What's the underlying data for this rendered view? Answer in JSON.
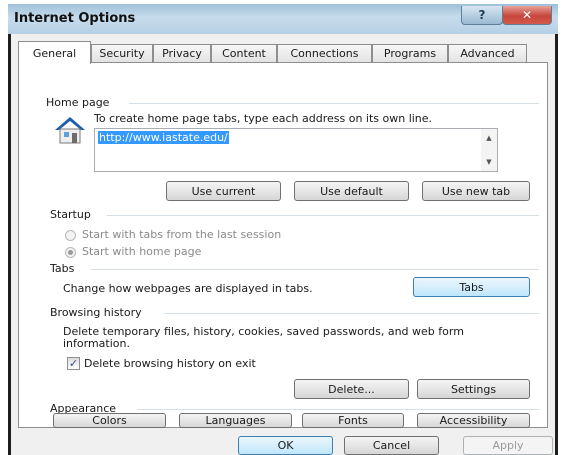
{
  "window": {
    "title": "Internet Options",
    "help_label": "?",
    "close_label": "✕"
  },
  "tabs": [
    {
      "label": "General",
      "active": true
    },
    {
      "label": "Security",
      "active": false
    },
    {
      "label": "Privacy",
      "active": false
    },
    {
      "label": "Content",
      "active": false
    },
    {
      "label": "Connections",
      "active": false
    },
    {
      "label": "Programs",
      "active": false
    },
    {
      "label": "Advanced",
      "active": false
    }
  ],
  "home_page": {
    "group_label": "Home page",
    "icon": "house-icon",
    "instructions": "To create home page tabs, type each address on its own line.",
    "url_value": "http://www.iastate.edu/",
    "buttons": {
      "use_current": "Use current",
      "use_default": "Use default",
      "use_new_tab": "Use new tab"
    }
  },
  "startup": {
    "group_label": "Startup",
    "options": [
      {
        "label": "Start with tabs from the last session",
        "checked": false
      },
      {
        "label": "Start with home page",
        "checked": true
      }
    ]
  },
  "tabs_group": {
    "group_label": "Tabs",
    "description": "Change how webpages are displayed in tabs.",
    "button_label": "Tabs"
  },
  "browsing_history": {
    "group_label": "Browsing history",
    "description": "Delete temporary files, history, cookies, saved passwords, and web form information.",
    "checkbox_label": "Delete browsing history on exit",
    "checkbox_checked": true,
    "delete_label": "Delete...",
    "settings_label": "Settings"
  },
  "appearance": {
    "group_label": "Appearance",
    "buttons": {
      "colors": "Colors",
      "languages": "Languages",
      "fonts": "Fonts",
      "accessibility": "Accessibility"
    }
  },
  "dialog_buttons": {
    "ok": "OK",
    "cancel": "Cancel",
    "apply": "Apply"
  },
  "colors": {
    "selection": "#3399ff",
    "focus_border": "#3c7fb1"
  }
}
